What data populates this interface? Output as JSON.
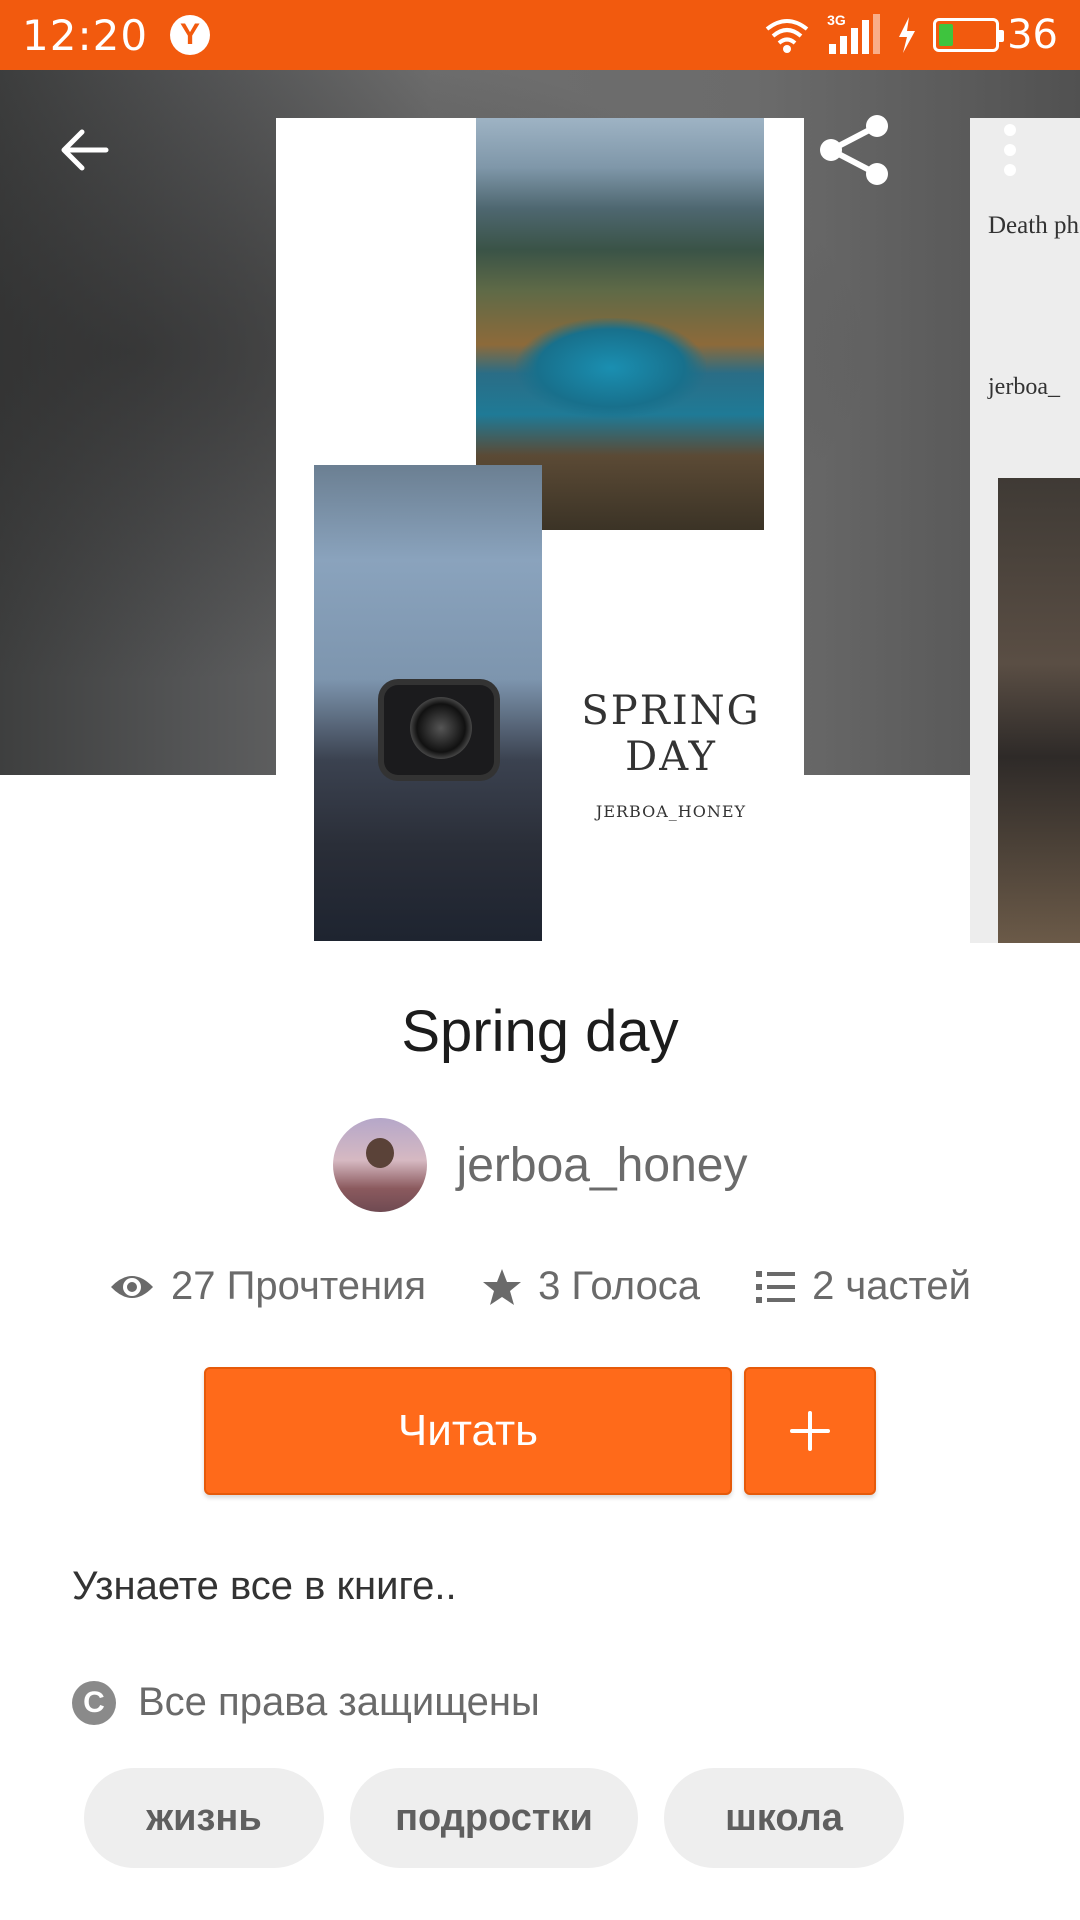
{
  "status_bar": {
    "time": "12:20",
    "browser_badge": "Y",
    "network_label": "3G",
    "battery_level": "36",
    "background_color": "#f25a0e"
  },
  "header": {
    "back_icon": "arrow-left-icon",
    "share_icon": "share-icon",
    "more_icon": "more-vertical-icon"
  },
  "cover": {
    "title": "SPRING DAY",
    "author": "JERBOA_HONEY"
  },
  "side_cover": {
    "title": "Death photogr",
    "author": "jerboa_"
  },
  "story": {
    "title": "Spring day",
    "author": "jerboa_honey"
  },
  "stats": {
    "reads": "27 Прочтения",
    "votes": "3 Голоса",
    "parts": "2 частей"
  },
  "actions": {
    "read_label": "Читать",
    "add_label": "+",
    "accent_color": "#ff6a1a"
  },
  "description": "Узнаете все в книге..",
  "copyright": {
    "icon_glyph": "C",
    "label": "Все права защищены"
  },
  "tags": [
    "жизнь",
    "подростки",
    "школа"
  ]
}
